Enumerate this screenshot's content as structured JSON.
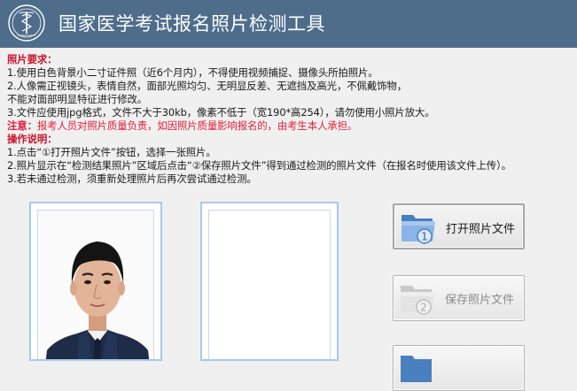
{
  "app": {
    "title": "国家医学考试报名照片检测工具",
    "logo_icon": "medical-caduceus-emblem",
    "theme": {
      "titlebar": "#4e6d8b",
      "warning": "#e0203a",
      "heading": "#c8152b"
    }
  },
  "requirements": {
    "heading": "照片要求：",
    "items": [
      "1.使用白色背景小二寸证件照（近6个月内），不得使用视频捕捉、摄像头所拍照片。",
      "2.人像需正视镜头，表情自然，面部光照均匀、无明显反差、无遮挡及高光，不佩戴饰物，",
      "不能对面部明显特征进行修改。",
      "3.文件应使用jpg格式，文件不大于30kb，像素不低于（宽190*高254），请勿使用小照片放大。"
    ],
    "warning_label": "注意：",
    "warning_text": "报考人员对照片质量负责，如因照片质量影响报名的，由考生本人承担。"
  },
  "instructions": {
    "heading": "操作说明：",
    "items": [
      "1.点击“①打开照片文件”按钮，选择一张照片。",
      "2.照片显示在“检测结果照片”区域后点击“②保存照片文件”得到通过检测的照片文件（在报名时使用该文件上传）。",
      "3.若未通过检测，须重新处理照片后再次尝试通过检测。"
    ]
  },
  "photos": {
    "original_icon": "portrait-photo",
    "result_icon": "empty-result-panel"
  },
  "buttons": {
    "open": {
      "label": "打开照片文件",
      "icon": "folder-1-icon",
      "enabled": true
    },
    "save": {
      "label": "保存照片文件",
      "icon": "folder-2-icon",
      "enabled": false
    }
  }
}
